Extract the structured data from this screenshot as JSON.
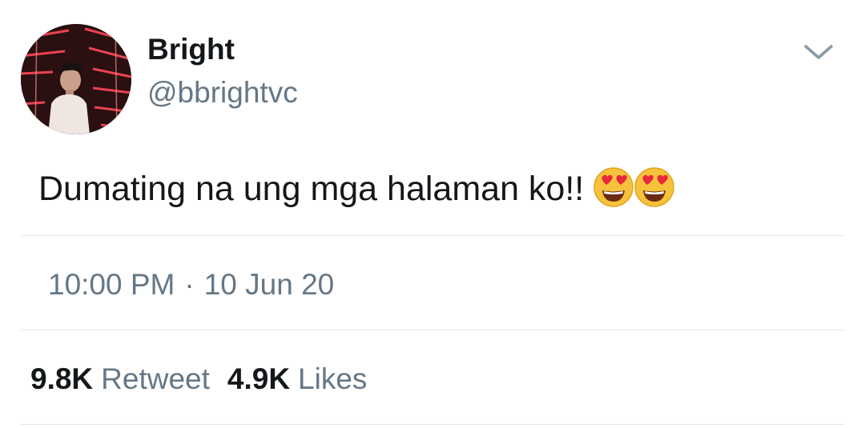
{
  "user": {
    "display_name": "Bright",
    "handle": "@bbrightvc"
  },
  "tweet": {
    "text": "Dumating na ung mga halaman ko!!",
    "emojis": [
      "smiling-face-with-heart-eyes",
      "smiling-face-with-heart-eyes"
    ],
    "time": "10:00 PM",
    "separator": "·",
    "date": "10 Jun 20"
  },
  "stats": {
    "retweets_count": "9.8K",
    "retweets_label": "Retweet",
    "likes_count": "4.9K",
    "likes_label": "Likes"
  },
  "icons": {
    "menu": "chevron-down-icon"
  },
  "colors": {
    "primary_text": "#14171a",
    "secondary_text": "#657786",
    "divider": "#e1e8ed",
    "emoji_face": "#f7c23b",
    "emoji_heart": "#e8283c"
  }
}
